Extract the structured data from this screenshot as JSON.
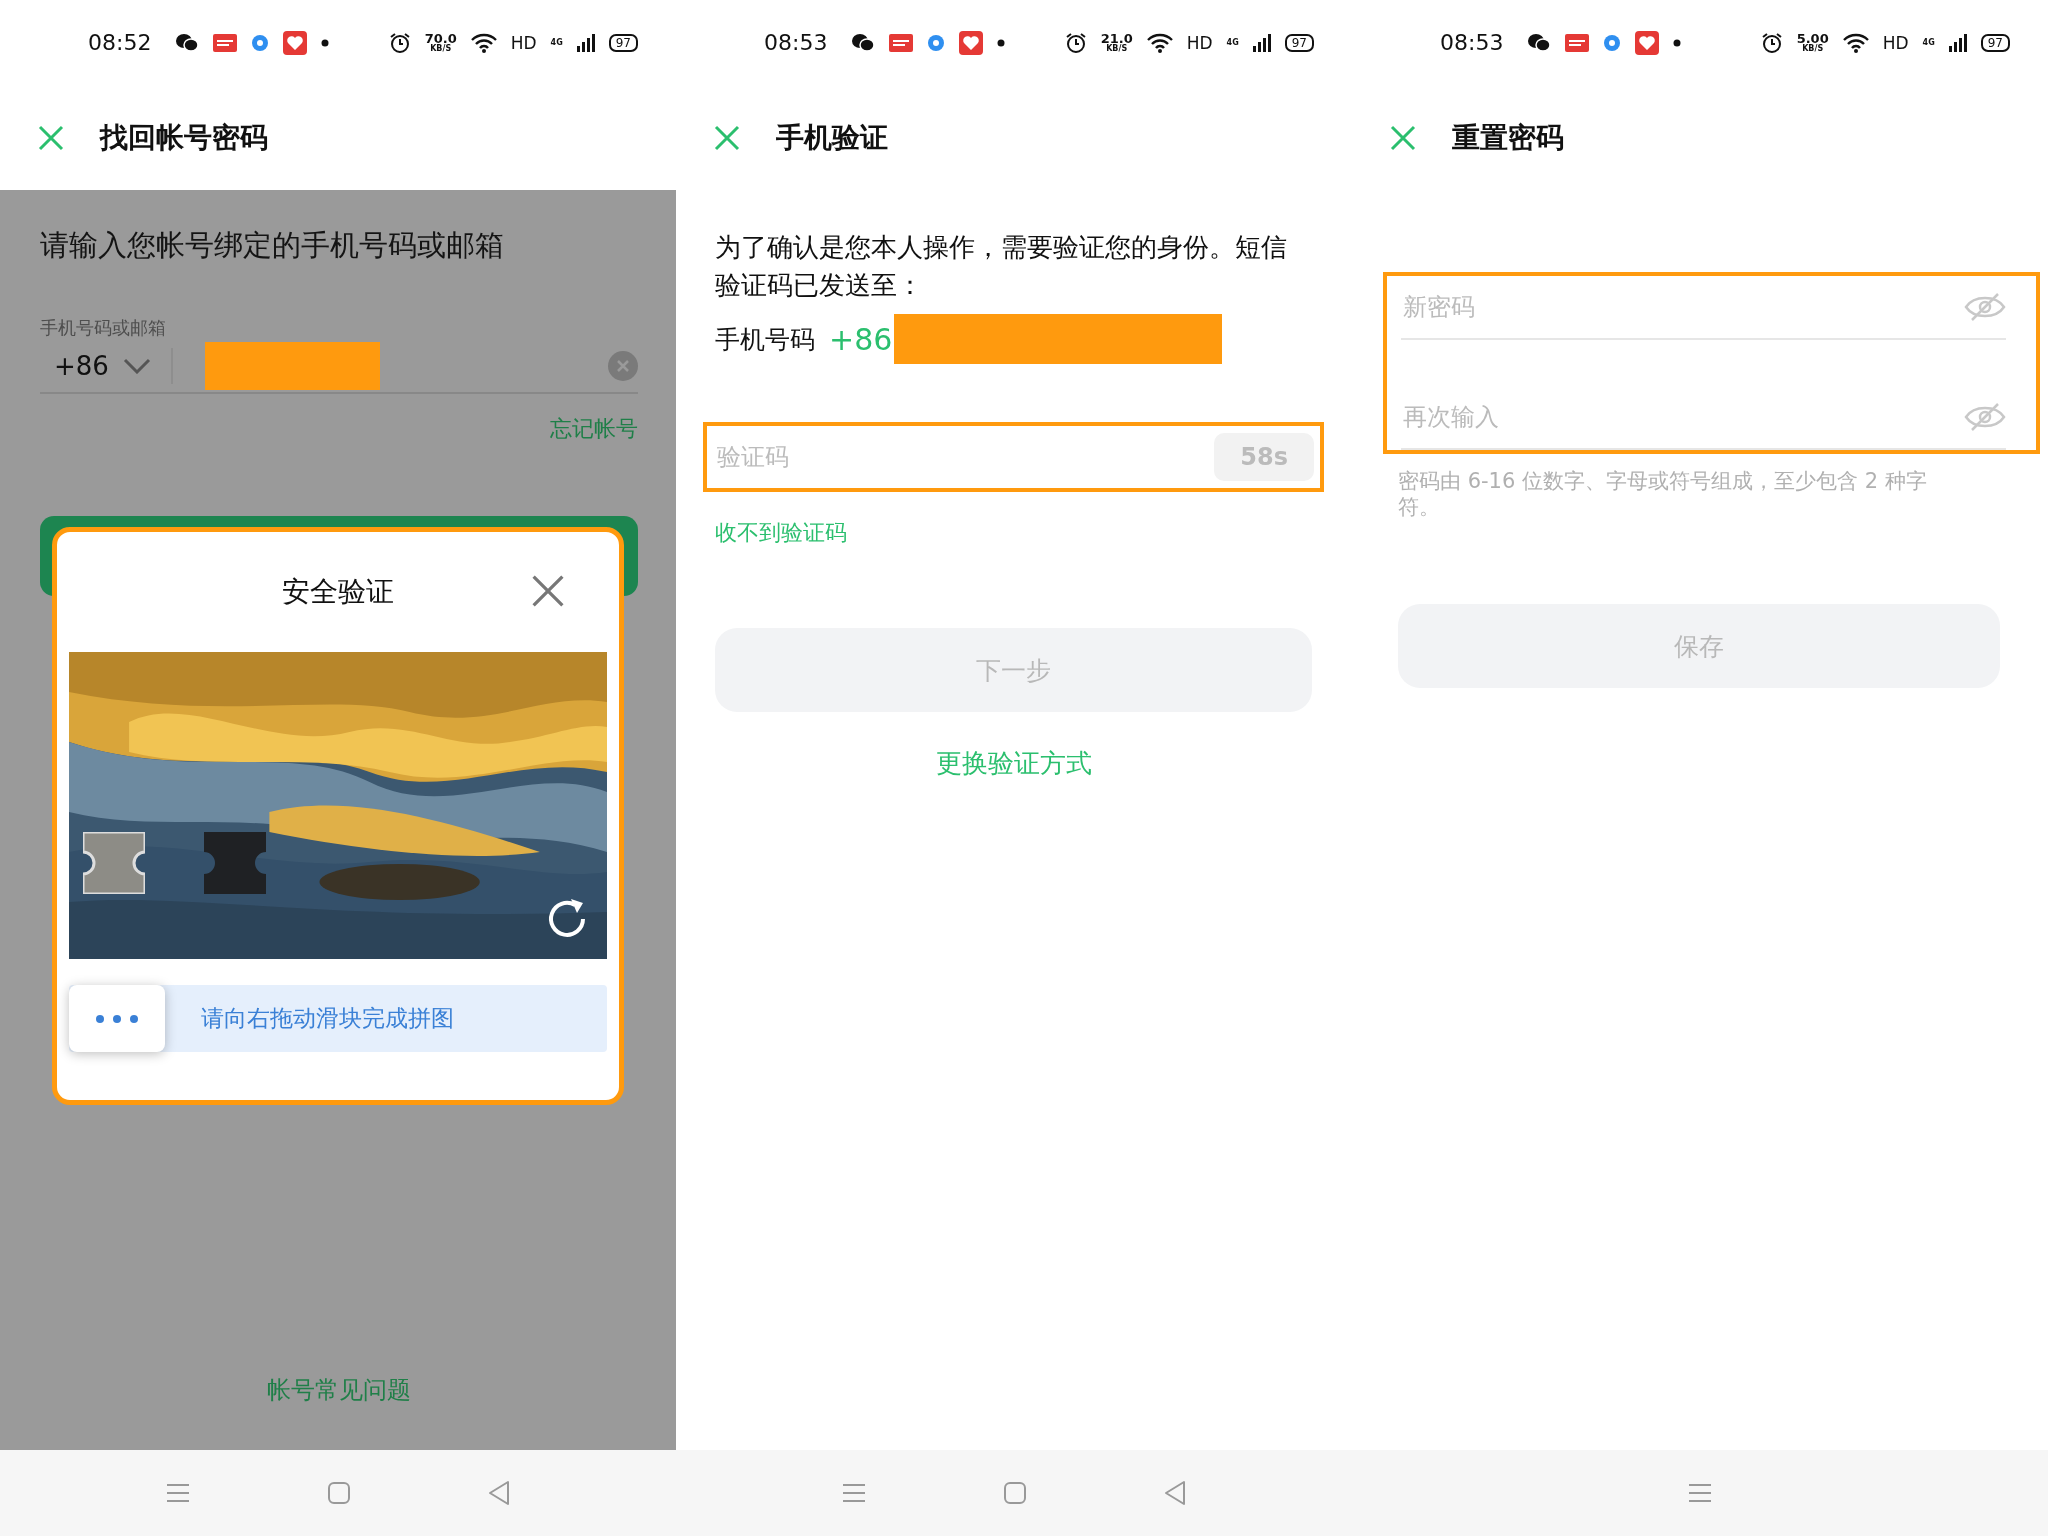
{
  "screens": [
    {
      "kind": "account",
      "dimmed": true,
      "status_bar": {
        "time": "08:52",
        "speed": "70.0",
        "speed_unit": "KB/S",
        "network": "HD",
        "signal": "4G",
        "battery": "97"
      },
      "header": {
        "title": "找回帐号密码"
      },
      "prompt": "请输入您帐号绑定的手机号码或邮箱",
      "field": {
        "label": "手机号码或邮箱",
        "country_code": "+86"
      },
      "forgot_link": "忘记帐号",
      "dialog": {
        "title": "安全验证",
        "slider_hint": "请向右拖动滑块完成拼图"
      },
      "faq_link": "帐号常见问题"
    },
    {
      "kind": "phone",
      "status_bar": {
        "time": "08:53",
        "speed": "21.0",
        "speed_unit": "KB/S",
        "network": "HD",
        "signal": "4G",
        "battery": "97"
      },
      "header": {
        "title": "手机验证"
      },
      "intro": "为了确认是您本人操作，需要验证您的身份。短信验证码已发送至：",
      "phone_label": "手机号码",
      "phone_code": "+86",
      "code_field": {
        "placeholder": "验证码",
        "countdown": "58s"
      },
      "no_code_link": "收不到验证码",
      "next_button": {
        "label": "下一步",
        "disabled": true
      },
      "switch_link": "更换验证方式"
    },
    {
      "kind": "reset",
      "status_bar": {
        "time": "08:53",
        "speed": "5.00",
        "speed_unit": "KB/S",
        "network": "HD",
        "signal": "4G",
        "battery": "97"
      },
      "header": {
        "title": "重置密码"
      },
      "fields": [
        {
          "placeholder": "新密码"
        },
        {
          "placeholder": "再次输入"
        }
      ],
      "hint": "密码由 6-16 位数字、字母或符号组成，至少包含 2 种字符。",
      "save_button": {
        "label": "保存",
        "disabled": true
      }
    }
  ]
}
